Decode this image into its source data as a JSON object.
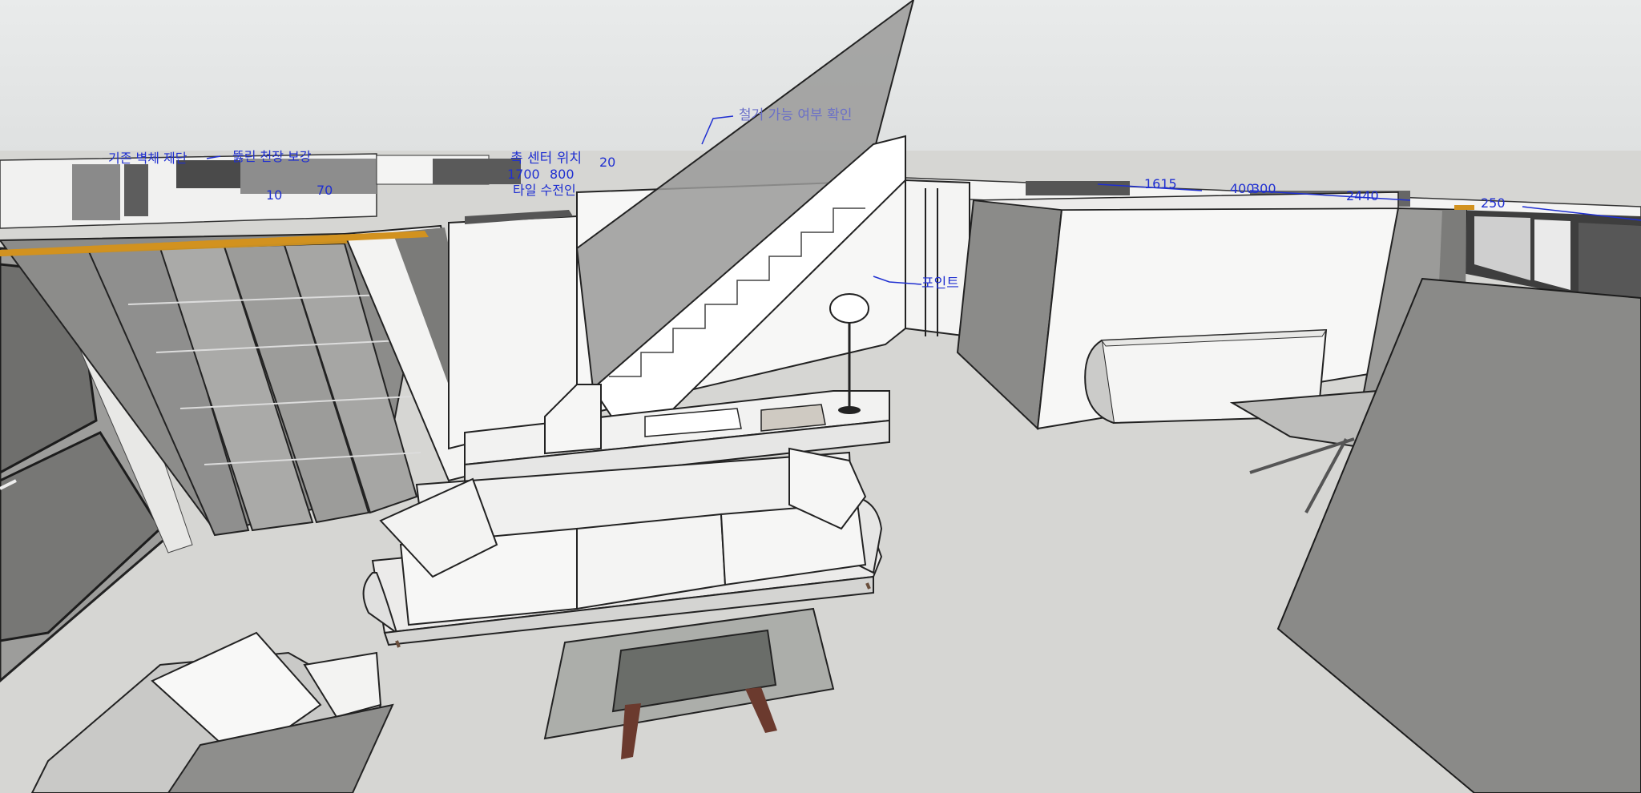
{
  "viewport": {
    "annotations": {
      "removal_check": "철거 가능 여부 확인",
      "point": "포인트",
      "existing_wall_cut": "기존 벽체 제단",
      "punch_ceiling": "뚫린 천장 보강",
      "center_pos": "촉 센터 위치",
      "tile_install": "타일 수전인",
      "dim_1615": "1615",
      "dim_400": "400",
      "dim_300": "300",
      "dim_2440": "2440",
      "dim_250": "250",
      "dim_70": "70",
      "dim_10": "10",
      "dim_1700": "1700",
      "dim_800": "800",
      "dim_20": "20"
    }
  }
}
